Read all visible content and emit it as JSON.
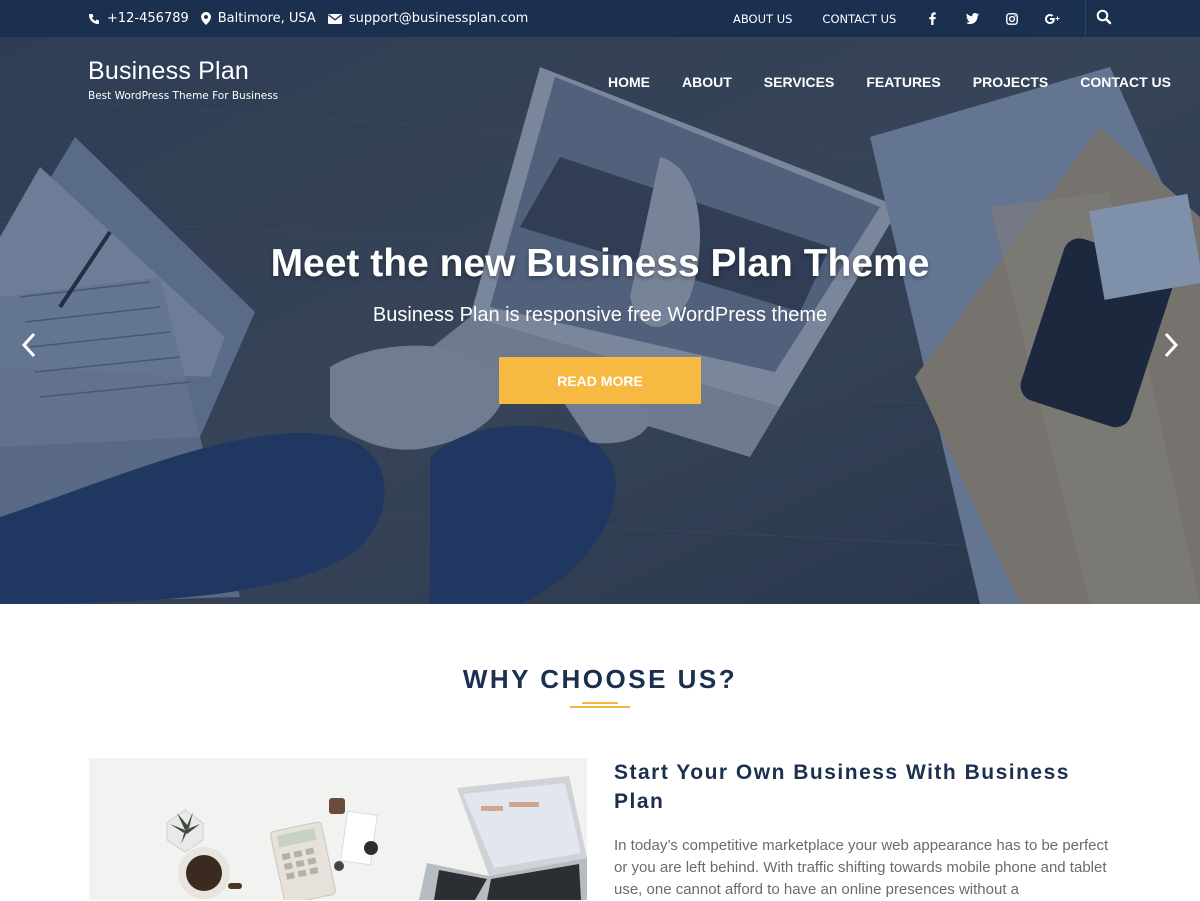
{
  "topbar": {
    "phone": "+12-456789",
    "location": "Baltimore, USA",
    "email": "support@businessplan.com",
    "links": [
      "ABOUT US",
      "CONTACT US"
    ],
    "social_icons": [
      "facebook-icon",
      "twitter-icon",
      "instagram-icon",
      "google-plus-icon"
    ],
    "search_icon": "search-icon",
    "background": "#1b2f4f"
  },
  "brand": {
    "title": "Business Plan",
    "tagline": "Best WordPress Theme For Business"
  },
  "nav": {
    "items": [
      "HOME",
      "ABOUT",
      "SERVICES",
      "FEATURES",
      "PROJECTS",
      "CONTACT US"
    ]
  },
  "hero": {
    "headline": "Meet the new Business Plan Theme",
    "subheadline": "Business Plan is responsive free WordPress theme",
    "button_label": "READ MORE",
    "button_color": "#f6b941",
    "prev_icon": "chevron-left-icon",
    "next_icon": "chevron-right-icon"
  },
  "why": {
    "heading": "WHY CHOOSE US?",
    "accent": "#f6b941"
  },
  "feature": {
    "title": "Start Your Own Business With Business Plan",
    "body": "In today’s competitive marketplace your web appearance has to be perfect or you are left behind. With traffic shifting towards mobile phone and tablet use, one cannot afford to have an online presences without a"
  }
}
